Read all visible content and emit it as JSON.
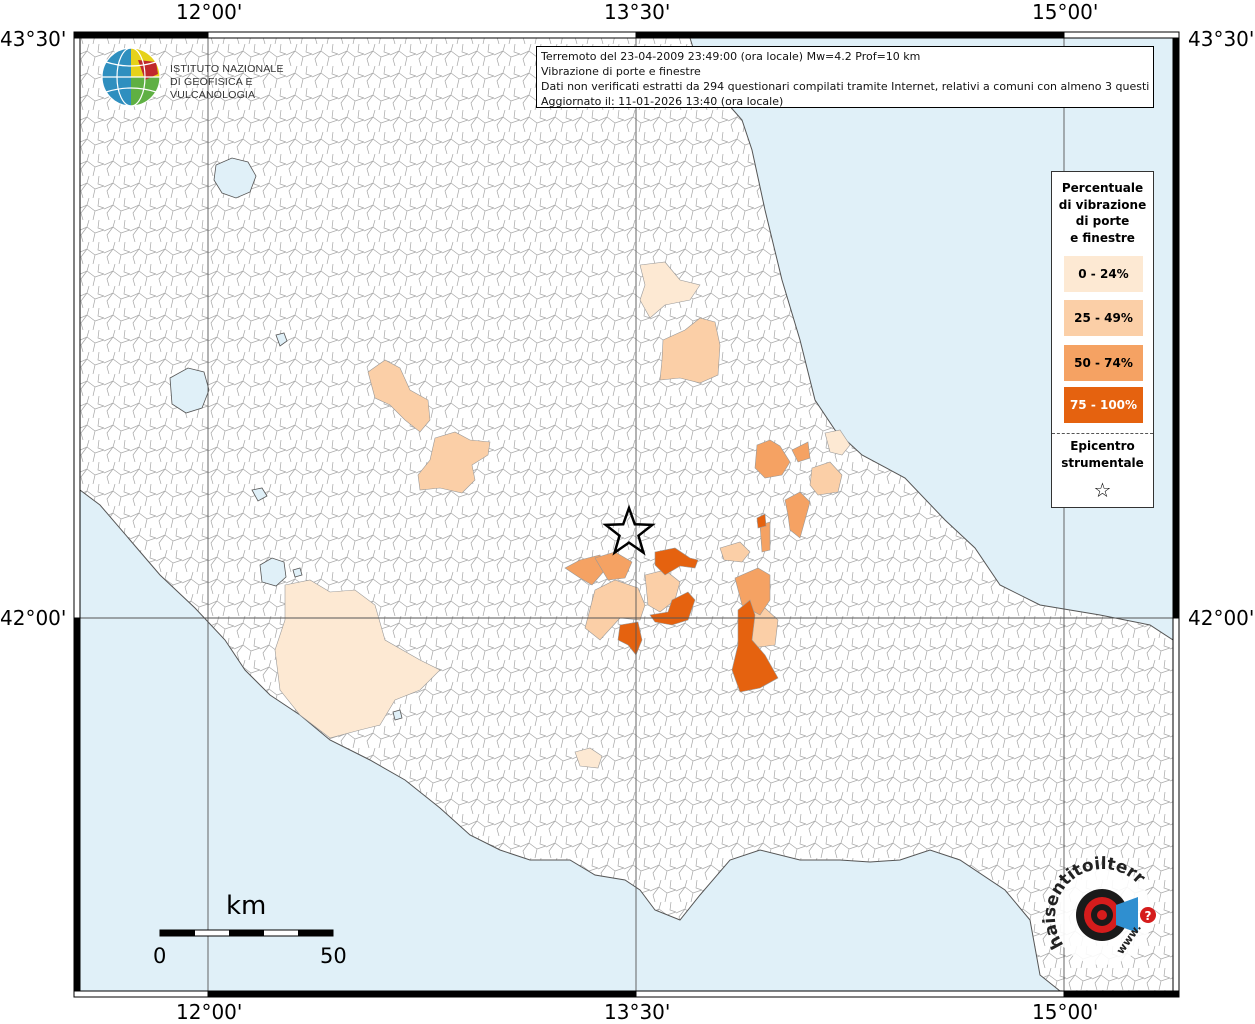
{
  "map": {
    "coords": {
      "top": [
        "12°00'",
        "13°30'",
        "15°00'"
      ],
      "bottom": [
        "12°00'",
        "13°30'",
        "15°00'"
      ],
      "left": [
        "43°30'",
        "42°00'"
      ],
      "right": [
        "43°30'",
        "42°00'"
      ]
    },
    "info": {
      "line1": "Terremoto del 23-04-2009 23:49:00 (ora locale) Mw=4.2 Prof=10 km",
      "line2": "Vibrazione di porte e finestre",
      "line3": "Dati non verificati estratti da 294 questionari compilati tramite Internet, relativi a comuni con almeno 3 questionari.",
      "line4": "Aggiornato il: 11-01-2026 13:40 (ora locale)"
    },
    "legend": {
      "title_lines": [
        "Percentuale",
        "di vibrazione",
        "di porte",
        "e finestre"
      ],
      "classes": [
        {
          "label": "0 - 24%",
          "color": "#fde9d3"
        },
        {
          "label": "25 - 49%",
          "color": "#fbcfa7"
        },
        {
          "label": "50 - 74%",
          "color": "#f5a263"
        },
        {
          "label": "75 - 100%",
          "color": "#e5620f"
        }
      ],
      "epicenter_lines": [
        "Epicentro",
        "strumentale"
      ],
      "epicenter_symbol": "☆"
    },
    "logo": {
      "name_line1": "ISTITUTO NAZIONALE",
      "name_line2": "DI GEOFISICA E VULCANOLOGIA"
    },
    "scale": {
      "unit": "km",
      "start": "0",
      "end": "50"
    },
    "badge": {
      "text": "haisentitoilterremoto.it",
      "url_text": "www.",
      "question_mark": "?"
    },
    "colors": {
      "sea": "#e0f0f8",
      "land": "#ffffff",
      "border": "#9a9a9a"
    }
  }
}
